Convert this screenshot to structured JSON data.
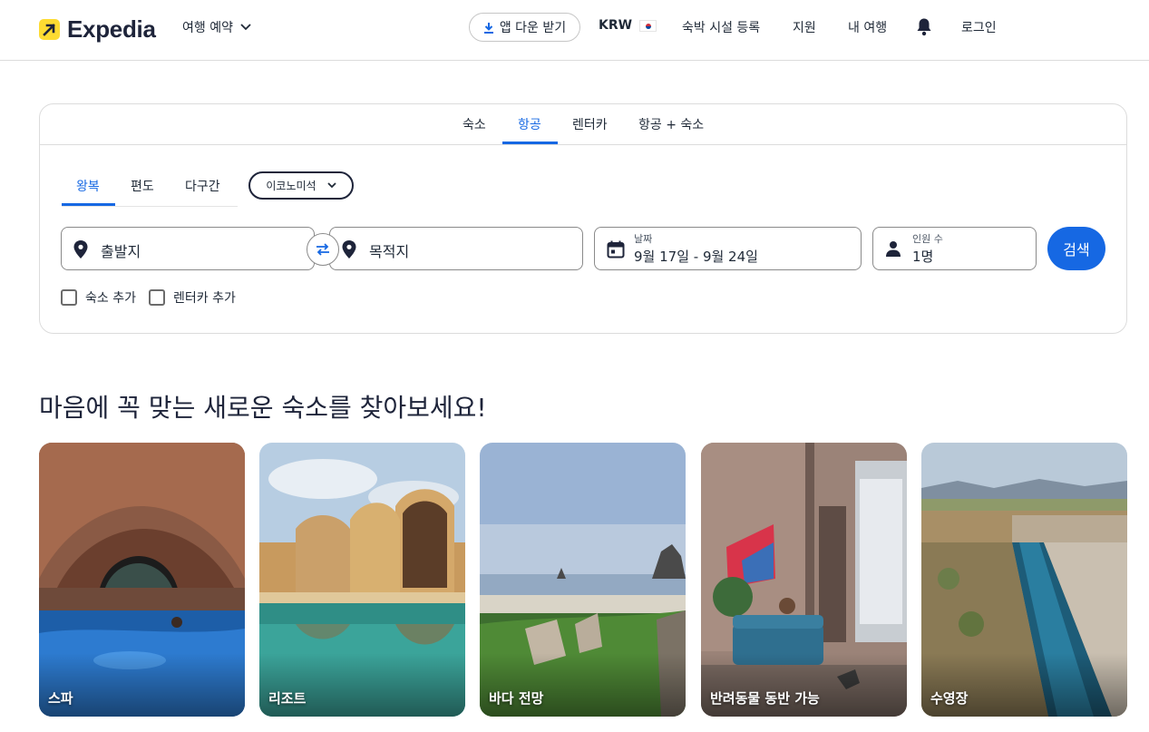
{
  "header": {
    "logo_text": "Expedia",
    "book_menu_label": "여행 예약",
    "app_button_label": "앱 다운 받기",
    "currency_label": "KRW",
    "list_property_label": "숙박 시설 등록",
    "support_label": "지원",
    "my_trips_label": "내 여행",
    "login_label": "로그인"
  },
  "search": {
    "tabs": [
      {
        "label": "숙소",
        "active": false
      },
      {
        "label": "항공",
        "active": true
      },
      {
        "label": "렌터카",
        "active": false
      },
      {
        "label": "항공 + 숙소",
        "active": false
      }
    ],
    "trip_types": [
      {
        "label": "왕복",
        "active": true
      },
      {
        "label": "편도",
        "active": false
      },
      {
        "label": "다구간",
        "active": false
      }
    ],
    "cabin_class": "이코노미석",
    "origin_placeholder": "출발지",
    "destination_placeholder": "목적지",
    "dates_label": "날짜",
    "dates_value": "9월 17일 - 9월 24일",
    "travelers_label": "인원 수",
    "travelers_value": "1명",
    "search_button": "검색",
    "add_stay_label": "숙소 추가",
    "add_car_label": "렌터카 추가"
  },
  "discover": {
    "title": "마음에 꼭 맞는 새로운 숙소를 찾아보세요!",
    "tiles": [
      {
        "label": "스파"
      },
      {
        "label": "리조트"
      },
      {
        "label": "바다 전망"
      },
      {
        "label": "반려동물 동반 가능"
      },
      {
        "label": "수영장"
      }
    ]
  },
  "colors": {
    "accent": "#1668e3",
    "brand_yellow": "#fddb32",
    "brand_navy": "#1e243a"
  }
}
